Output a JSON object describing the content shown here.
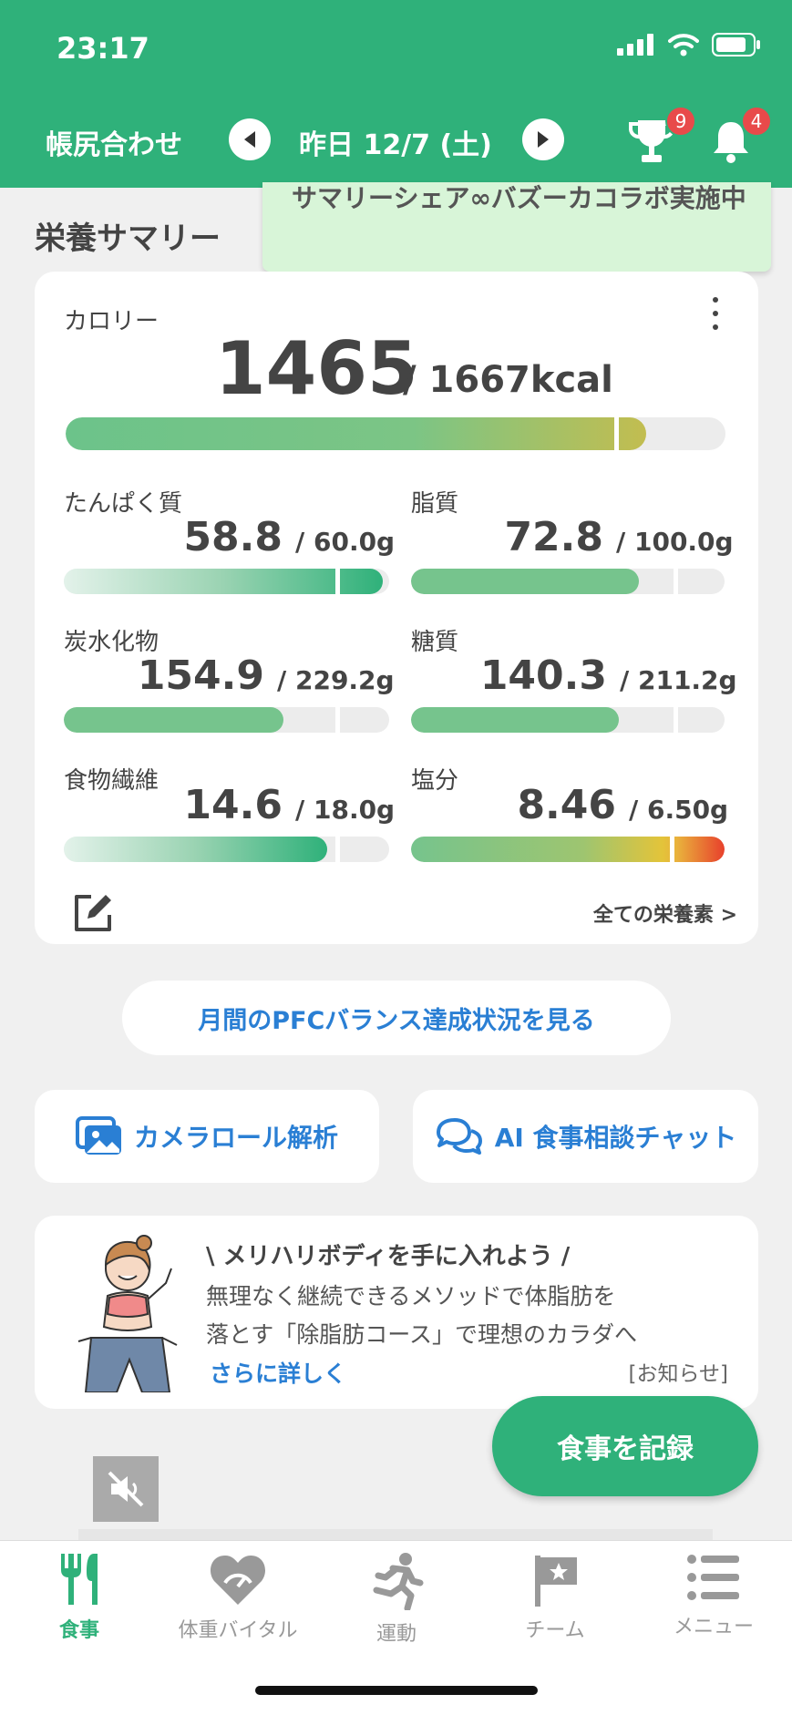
{
  "status": {
    "time": "23:17"
  },
  "header": {
    "left_label": "帳尻合わせ",
    "date": "昨日 12/7 (土)",
    "trophy_badge": "9",
    "bell_badge": "4"
  },
  "summary": {
    "title": "栄養サマリー",
    "tooltip": "サマリーシェア∞バズーカコラボ実施中",
    "calorie": {
      "label": "カロリー",
      "value": "1465",
      "target": "/ 1667kcal",
      "progress": 0.88
    },
    "nutrients": [
      {
        "label": "たんぱく質",
        "value": "58.8",
        "target": "/ 60.0g",
        "progress": 0.98
      },
      {
        "label": "脂質",
        "value": "72.8",
        "target": "/ 100.0g",
        "progress": 0.728
      },
      {
        "label": "炭水化物",
        "value": "154.9",
        "target": "/ 229.2g",
        "progress": 0.676
      },
      {
        "label": "糖質",
        "value": "140.3",
        "target": "/ 211.2g",
        "progress": 0.664
      },
      {
        "label": "食物繊維",
        "value": "14.6",
        "target": "/ 18.0g",
        "progress": 0.81
      },
      {
        "label": "塩分",
        "value": "8.46",
        "target": "/ 6.50g",
        "progress": 1.0
      }
    ],
    "all_nutrients_link": "全ての栄養素 >"
  },
  "pfc_button": "月間のPFCバランス達成状況を見る",
  "actions": {
    "camera_roll": "カメラロール解析",
    "ai_chat": "AI 食事相談チャット"
  },
  "promo": {
    "headline": "\\ メリハリボディを手に入れよう /",
    "body_line1": "無理なく継続できるメソッドで体脂肪を",
    "body_line2": "落とす「除脂肪コース」で理想のカラダへ",
    "link": "さらに詳しく",
    "tag": "[お知らせ]"
  },
  "record_button": "食事を記録",
  "tabs": [
    {
      "label": "食事",
      "icon": "fork-knife-icon",
      "active": true
    },
    {
      "label": "体重バイタル",
      "icon": "heart-scale-icon",
      "active": false
    },
    {
      "label": "運動",
      "icon": "runner-icon",
      "active": false
    },
    {
      "label": "チーム",
      "icon": "flag-icon",
      "active": false
    },
    {
      "label": "メニュー",
      "icon": "list-icon",
      "active": false
    }
  ],
  "colors": {
    "brand_green": "#2fb17a",
    "link_blue": "#2a7fd4",
    "badge_red": "#e84a4a"
  }
}
